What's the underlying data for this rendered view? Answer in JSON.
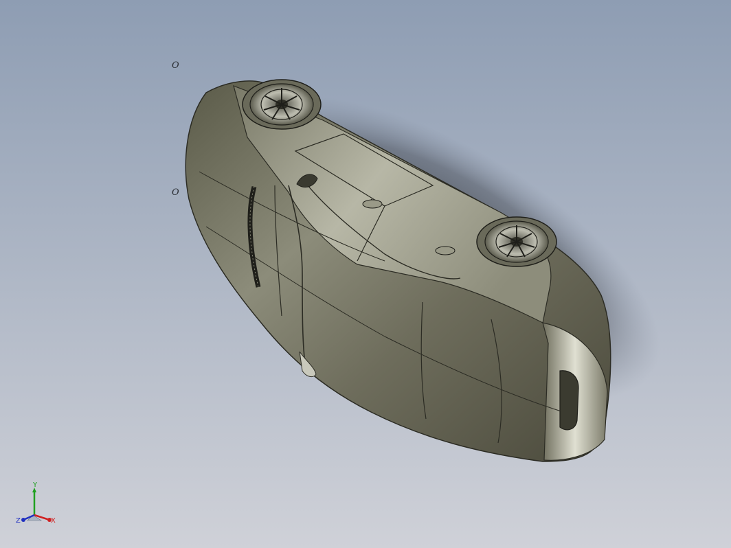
{
  "colors": {
    "background_top": "#8e9db3",
    "background_bottom": "#c9ccd4",
    "body_dark": "#4b4a3c",
    "body_mid": "#8a8a78",
    "body_light": "#d6d6c8",
    "axis_x": "#d02020",
    "axis_y": "#20a020",
    "axis_z": "#2030c0"
  },
  "sketch_markers": [
    {
      "label": "O"
    },
    {
      "label": "O"
    }
  ],
  "triad": {
    "x_label": "X",
    "y_label": "Y",
    "z_label": "Z"
  },
  "model": {
    "icon": "car-body-3d-model"
  }
}
